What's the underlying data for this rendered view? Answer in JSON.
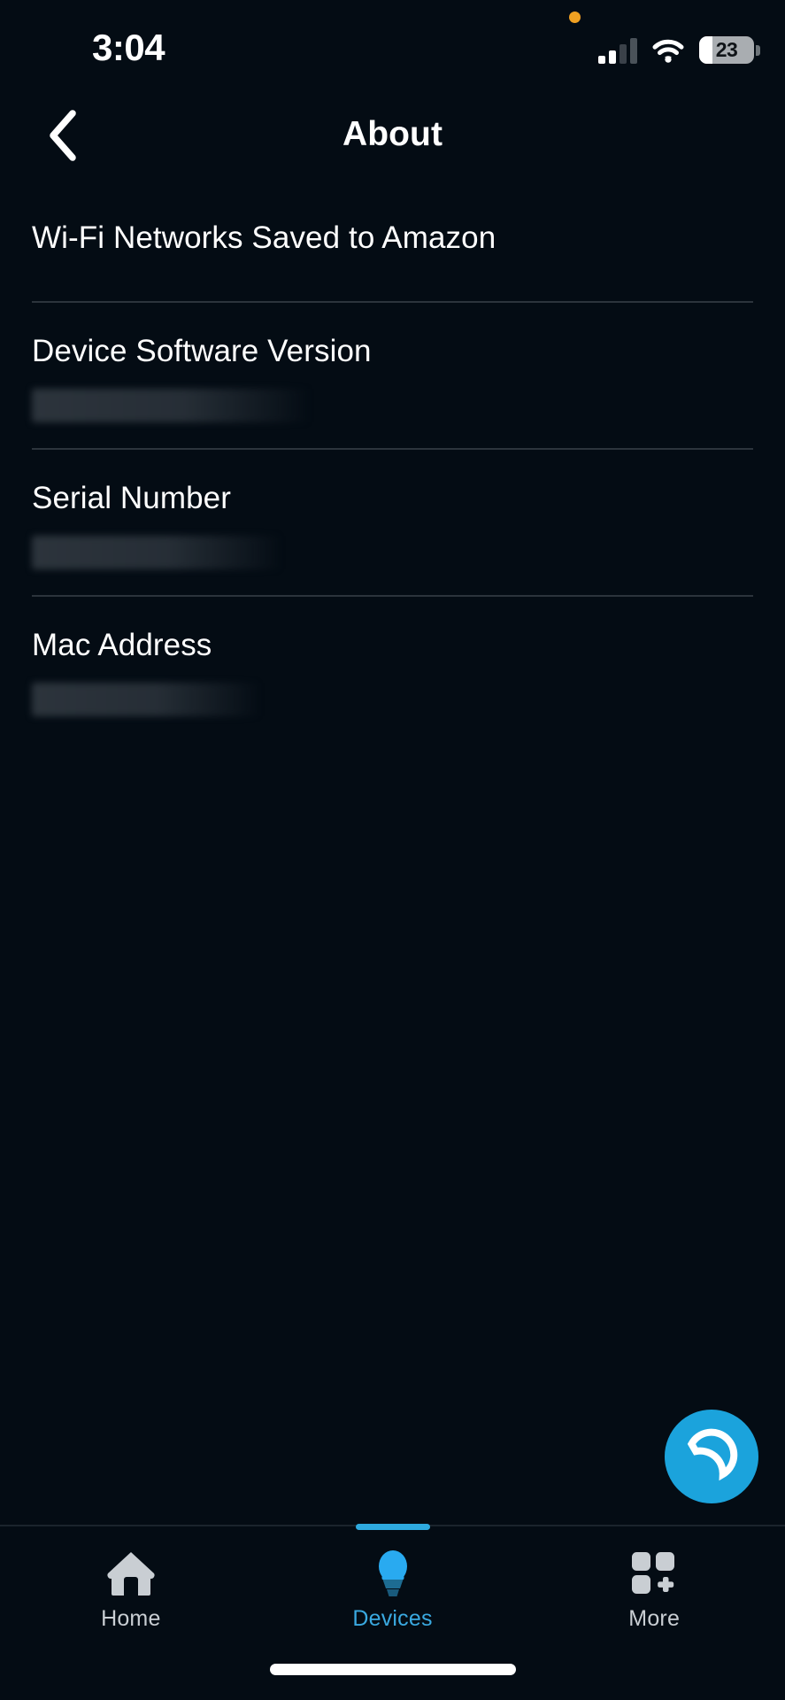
{
  "status_bar": {
    "time": "3:04",
    "recording_dot": "orange-recording-dot",
    "signal_icon": "cellular-signal-icon",
    "signal_bars_filled": 2,
    "signal_bars_total": 4,
    "wifi_icon": "wifi-icon",
    "battery_percent": "23",
    "battery_icon": "battery-icon"
  },
  "header": {
    "back_icon": "chevron-left-icon",
    "title": "About"
  },
  "list": {
    "rows": [
      {
        "label": "Wi-Fi Networks Saved to Amazon",
        "value": "",
        "redacted": false
      },
      {
        "label": "Device Software Version",
        "value": "",
        "redacted": true
      },
      {
        "label": "Serial Number",
        "value": "",
        "redacted": true
      },
      {
        "label": "Mac Address",
        "value": "",
        "redacted": true
      }
    ]
  },
  "alexa_button": {
    "icon": "alexa-logo-icon",
    "color": "#1ba3dc"
  },
  "tab_bar": {
    "active_index": 1,
    "accent_color": "#3aa9e0",
    "inactive_color": "#c9ced3",
    "tabs": [
      {
        "label": "Home",
        "icon": "home-icon"
      },
      {
        "label": "Devices",
        "icon": "lightbulb-icon"
      },
      {
        "label": "More",
        "icon": "grid-plus-icon"
      }
    ]
  },
  "system": {
    "home_indicator": "home-indicator-bar"
  },
  "theme": {
    "background": "#040c14",
    "divider": "#2c343c",
    "text_primary": "#ffffff"
  }
}
